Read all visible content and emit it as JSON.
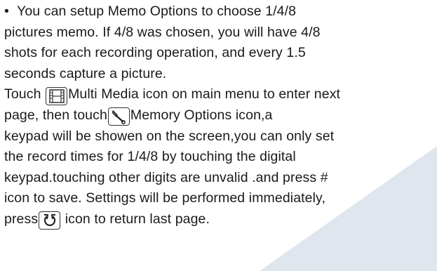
{
  "paragraph1": {
    "bullet": "•",
    "lines": [
      "You can setup Memo Options to choose 1/4/8",
      "pictures memo. If 4/8 was chosen, you will have 4/8",
      "shots for each recording operation, and every 1.5",
      "seconds capture a picture."
    ]
  },
  "paragraph2": {
    "line1_before": "Touch ",
    "line1_after": "Multi Media icon on main menu to enter next",
    "line2_before": "page, then touch",
    "line2_after": "Memory Options icon,a",
    "lines": [
      " keypad will be showen on the screen,you can only set",
      "the record times for 1/4/8 by touching the digital",
      "keypad.touching other digits are unvalid .and press #",
      "icon to save. Settings will be performed immediately,"
    ],
    "last_before": "press",
    "last_after": " icon to return last page."
  },
  "icons": {
    "multimedia": "film-strip-icon",
    "memory_options": "wrench-icon",
    "return": "return-arrow-icon"
  },
  "colors": {
    "text": "#1a1a1a",
    "background_shape": "#dfe6ee"
  }
}
